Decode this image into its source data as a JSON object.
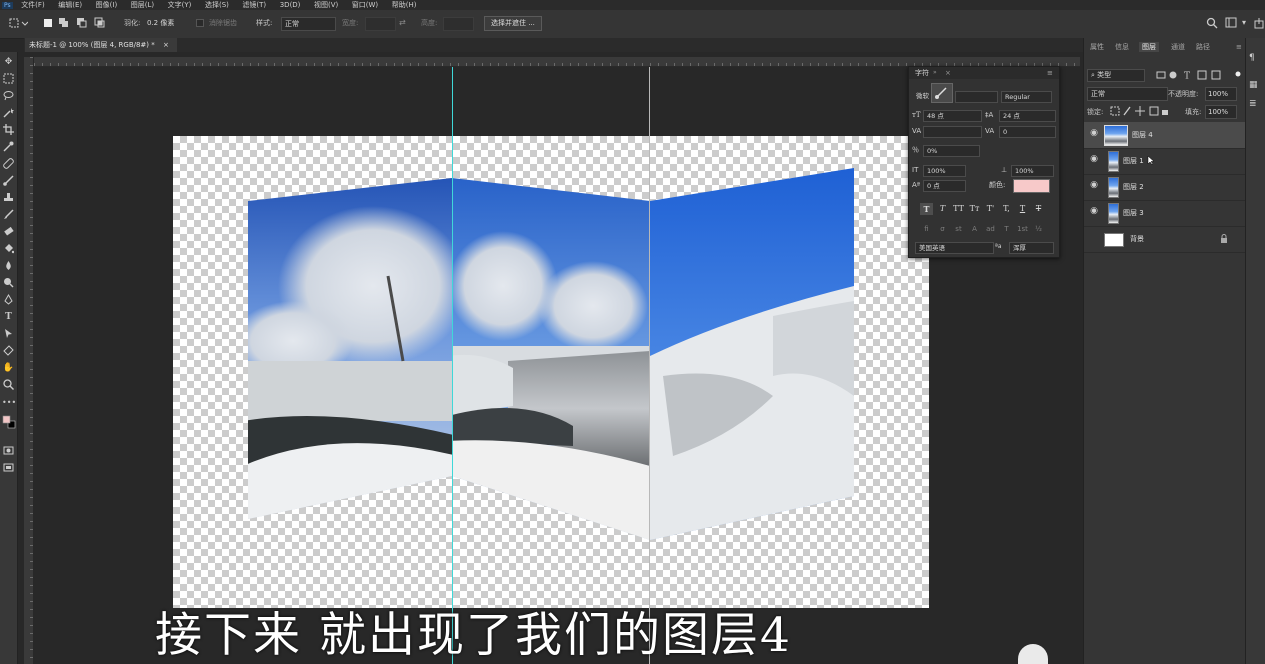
{
  "menubar": {
    "logo": "Ps",
    "items": [
      "文件(F)",
      "编辑(E)",
      "图像(I)",
      "图层(L)",
      "文字(Y)",
      "选择(S)",
      "滤镜(T)",
      "3D(D)",
      "视图(V)",
      "窗口(W)",
      "帮助(H)"
    ]
  },
  "options": {
    "feather_label": "羽化:",
    "feather_value": "0.2 像素",
    "antialias_label": "消除锯齿",
    "style_label": "样式:",
    "style_value": "正常",
    "width_label": "宽度:",
    "height_label": "高度:",
    "select_mask_button": "选择并遮住 ..."
  },
  "document": {
    "tab_title": "未标题-1 @ 100% (图层 4, RGB/8#) *",
    "close_glyph": "×"
  },
  "subtitle": "接下来 就出现了我们的图层4",
  "character_panel": {
    "title": "字符",
    "font_family_value": "微软",
    "font_style_value": "Regular",
    "font_size": "48 点",
    "leading": "24 点",
    "kerning": "",
    "tracking": "0",
    "scale_tsume": "0%",
    "vertical_scale": "100%",
    "horizontal_scale": "100%",
    "baseline_shift": "0 点",
    "color_label": "颜色:",
    "color": "#f7c9c9",
    "language": "美国英语",
    "antialias": "浑厚",
    "format_buttons": [
      "T",
      "T",
      "TT",
      "Tт",
      "T'",
      "T,",
      "T",
      "T"
    ],
    "opentype_buttons": [
      "fi",
      "σ",
      "st",
      "A",
      "ad",
      "T",
      "1st",
      "½"
    ]
  },
  "layers_panel": {
    "tabs": [
      "属性",
      "信息",
      "图层",
      "通道",
      "路径"
    ],
    "active_tab": "图层",
    "filter_label": "类型",
    "blend_mode": "正常",
    "opacity_label": "不透明度:",
    "opacity_value": "100%",
    "lock_label": "锁定:",
    "fill_label": "填充:",
    "fill_value": "100%",
    "layers": [
      {
        "name": "图层 4",
        "visible": true,
        "selected": true
      },
      {
        "name": "图层 1",
        "visible": true,
        "selected": false
      },
      {
        "name": "图层 2",
        "visible": true,
        "selected": false
      },
      {
        "name": "图层 3",
        "visible": true,
        "selected": false
      },
      {
        "name": "背景",
        "visible": false,
        "selected": false,
        "locked": true
      }
    ]
  },
  "colors": {
    "guide_cyan": "#3fd8d8",
    "guide_gray": "#b8b8b8",
    "foreground": "#f2c6c6",
    "background": "#000000"
  }
}
